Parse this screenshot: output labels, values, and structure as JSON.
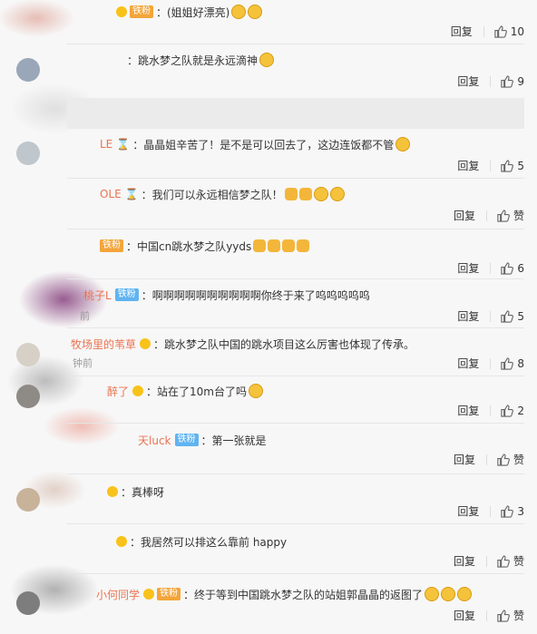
{
  "comments": [
    {
      "name": "",
      "badge": "铁粉",
      "badge_color": "orange",
      "vip": true,
      "hourglass": false,
      "text": "：(姐姐好漂亮)",
      "time": "",
      "reply": "回复",
      "likes": "10"
    },
    {
      "name": "",
      "badge": "",
      "badge_color": "",
      "vip": false,
      "hourglass": false,
      "text": "：跳水梦之队就是永远滴神",
      "time": "",
      "reply": "回复",
      "likes": "9"
    },
    {
      "name": "LE",
      "badge": "",
      "badge_color": "",
      "vip": false,
      "hourglass": true,
      "text": "：晶晶姐辛苦了！是不是可以回去了，这边连饭都不管",
      "time": "",
      "reply": "回复",
      "likes": "5"
    },
    {
      "name": "OLE",
      "badge": "",
      "badge_color": "",
      "vip": false,
      "hourglass": true,
      "text": "：我们可以永远相信梦之队！",
      "time": "",
      "reply": "回复",
      "likes": "赞"
    },
    {
      "name": "",
      "badge": "铁粉",
      "badge_color": "orange",
      "vip": false,
      "hourglass": false,
      "text": "：中国cn跳水梦之队yyds",
      "time": "",
      "reply": "回复",
      "likes": "6"
    },
    {
      "name": "桃子L",
      "badge": "铁粉",
      "badge_color": "blue",
      "vip": false,
      "hourglass": false,
      "text": "：啊啊啊啊啊啊啊啊啊啊你终于来了呜呜呜呜呜",
      "time": "前",
      "reply": "回复",
      "likes": "5"
    },
    {
      "name": "牧场里的苇草",
      "badge": "",
      "badge_color": "",
      "vip": true,
      "hourglass": false,
      "text": "：跳水梦之队中国的跳水项目这么厉害也体现了传承。",
      "time": "钟前",
      "reply": "回复",
      "likes": "8"
    },
    {
      "name": "醉了",
      "badge": "",
      "badge_color": "",
      "vip": true,
      "hourglass": false,
      "text": "：站在了10m台了吗",
      "time": "",
      "reply": "回复",
      "likes": "2"
    },
    {
      "name": "天luck",
      "badge": "铁粉",
      "badge_color": "blue",
      "vip": false,
      "hourglass": false,
      "text": "：第一张就是",
      "time": "",
      "reply": "回复",
      "likes": "赞"
    },
    {
      "name": "",
      "badge": "",
      "badge_color": "",
      "vip": true,
      "hourglass": false,
      "text": "：真棒呀",
      "time": "",
      "reply": "回复",
      "likes": "3"
    },
    {
      "name": "",
      "badge": "",
      "badge_color": "",
      "vip": true,
      "hourglass": false,
      "text": "：我居然可以排这么靠前 happy",
      "time": "",
      "reply": "回复",
      "likes": "赞"
    },
    {
      "name": "小何同学",
      "badge": "铁粉",
      "badge_color": "orange",
      "vip": true,
      "hourglass": false,
      "text": "：终于等到中国跳水梦之队的站姐郭晶晶的返图了",
      "time": "",
      "reply": "回复",
      "likes": "赞"
    }
  ]
}
